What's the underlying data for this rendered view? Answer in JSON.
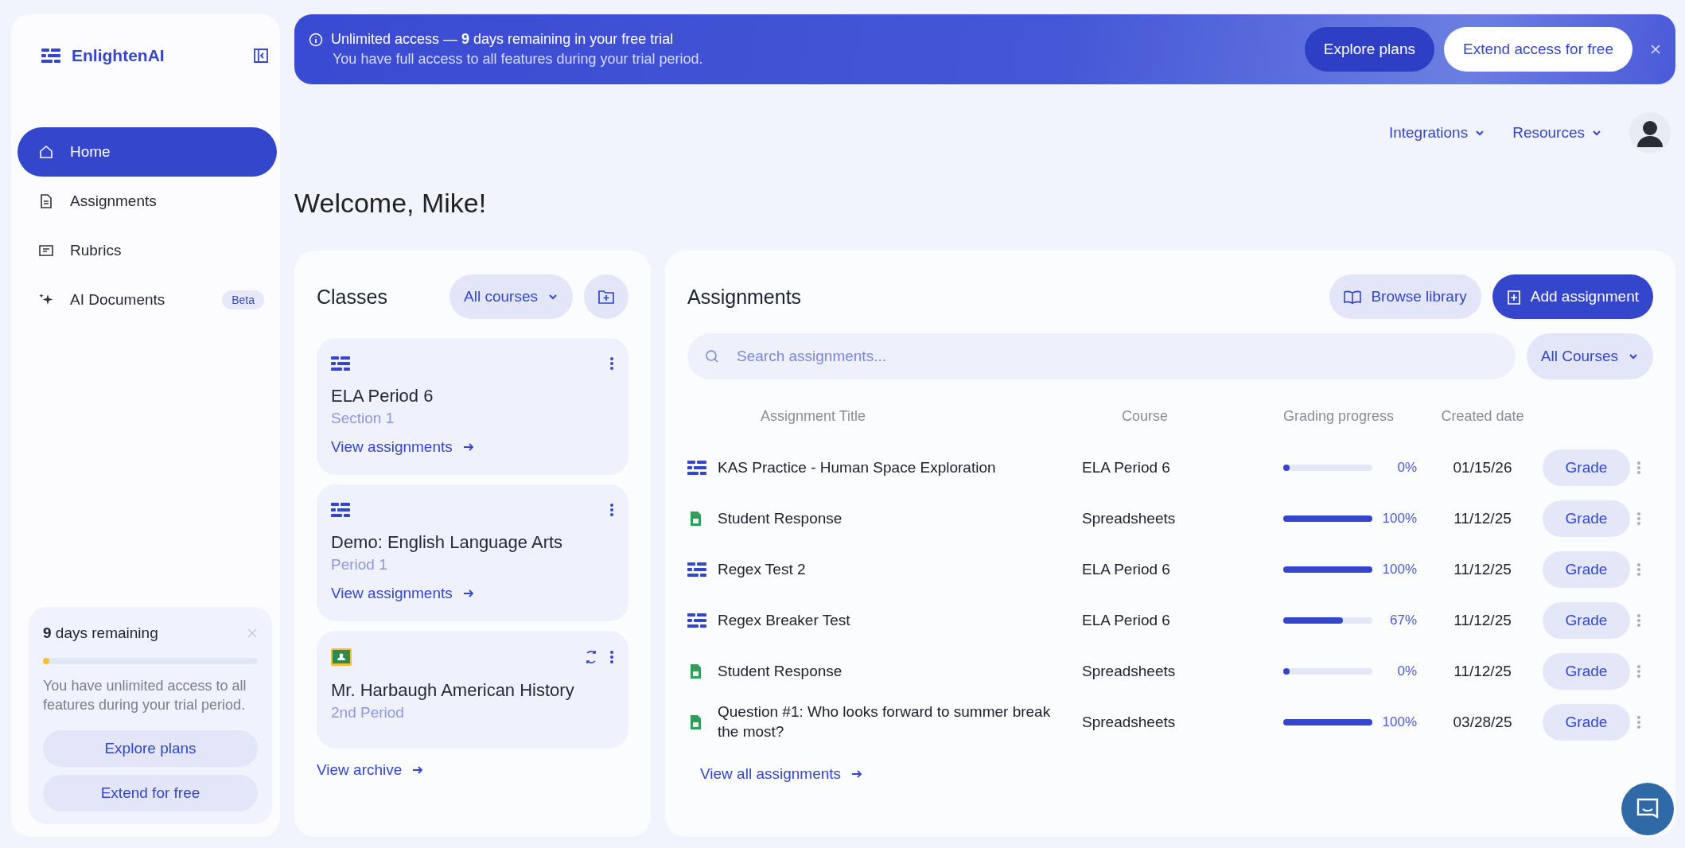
{
  "sidebar": {
    "brand": "EnlightenAI",
    "items": [
      {
        "label": "Home",
        "selected": true
      },
      {
        "label": "Assignments",
        "selected": false
      },
      {
        "label": "Rubrics",
        "selected": false
      },
      {
        "label": "AI Documents",
        "selected": false,
        "badge": "Beta"
      }
    ],
    "trial": {
      "title": "**9** days remaining",
      "level": 0.02,
      "text": "You have unlimited access to all features during your trial period.",
      "buttons": [
        "Explore plans",
        "Extend for free"
      ]
    }
  },
  "banner": {
    "title": "Unlimited access — **9** days remaining in your free trial",
    "subtitle": "You have full access to all features during your trial period.",
    "primary": "Explore plans",
    "secondary": "Extend access for free"
  },
  "top_nav": [
    "Integrations",
    "Resources"
  ],
  "greeting": "Welcome, Mike!",
  "classes": {
    "title": "Classes",
    "filter": "All courses",
    "cards": [
      {
        "kind": "enlighten",
        "name": "ELA Period 6",
        "section": "Section 1",
        "link": "View assignments",
        "synced": false
      },
      {
        "kind": "enlighten",
        "name": "Demo: English Language Arts",
        "section": "Period 1",
        "link": "View assignments",
        "synced": false
      },
      {
        "kind": "classroom",
        "name": "Mr. Harbaugh American History",
        "section": "2nd Period",
        "synced": true
      }
    ],
    "archive": "View archive"
  },
  "assignments": {
    "title": "Assignments",
    "browse": "Browse library",
    "add": "Add assignment",
    "search": {
      "placeholder": "Search assignments..."
    },
    "filter": "All Courses",
    "columns": [
      "Assignment Title",
      "Course",
      "Grading progress",
      "Created date"
    ],
    "rows": [
      {
        "kind": "enlighten",
        "title": "KAS Practice - Human Space Exploration",
        "course": "ELA Period 6",
        "level": 0,
        "reading": "0%",
        "date": "01/15/26",
        "action": "Grade"
      },
      {
        "kind": "sheet",
        "title": "Student Response",
        "course": "Spreadsheets",
        "level": 1,
        "reading": "100%",
        "date": "11/12/25",
        "action": "Grade"
      },
      {
        "kind": "enlighten",
        "title": "Regex Test 2",
        "course": "ELA Period 6",
        "level": 1,
        "reading": "100%",
        "date": "11/12/25",
        "action": "Grade"
      },
      {
        "kind": "enlighten",
        "title": "Regex Breaker Test",
        "course": "ELA Period 6",
        "level": 0.67,
        "reading": "67%",
        "date": "11/12/25",
        "action": "Grade"
      },
      {
        "kind": "sheet",
        "title": "Student Response",
        "course": "Spreadsheets",
        "level": 0,
        "reading": "0%",
        "date": "11/12/25",
        "action": "Grade"
      },
      {
        "kind": "sheet",
        "title": "Question #1: Who looks forward to summer break the most?",
        "course": "Spreadsheets",
        "level": 1,
        "reading": "100%",
        "date": "03/28/25",
        "action": "Grade"
      }
    ],
    "view_all": "View all assignments"
  }
}
